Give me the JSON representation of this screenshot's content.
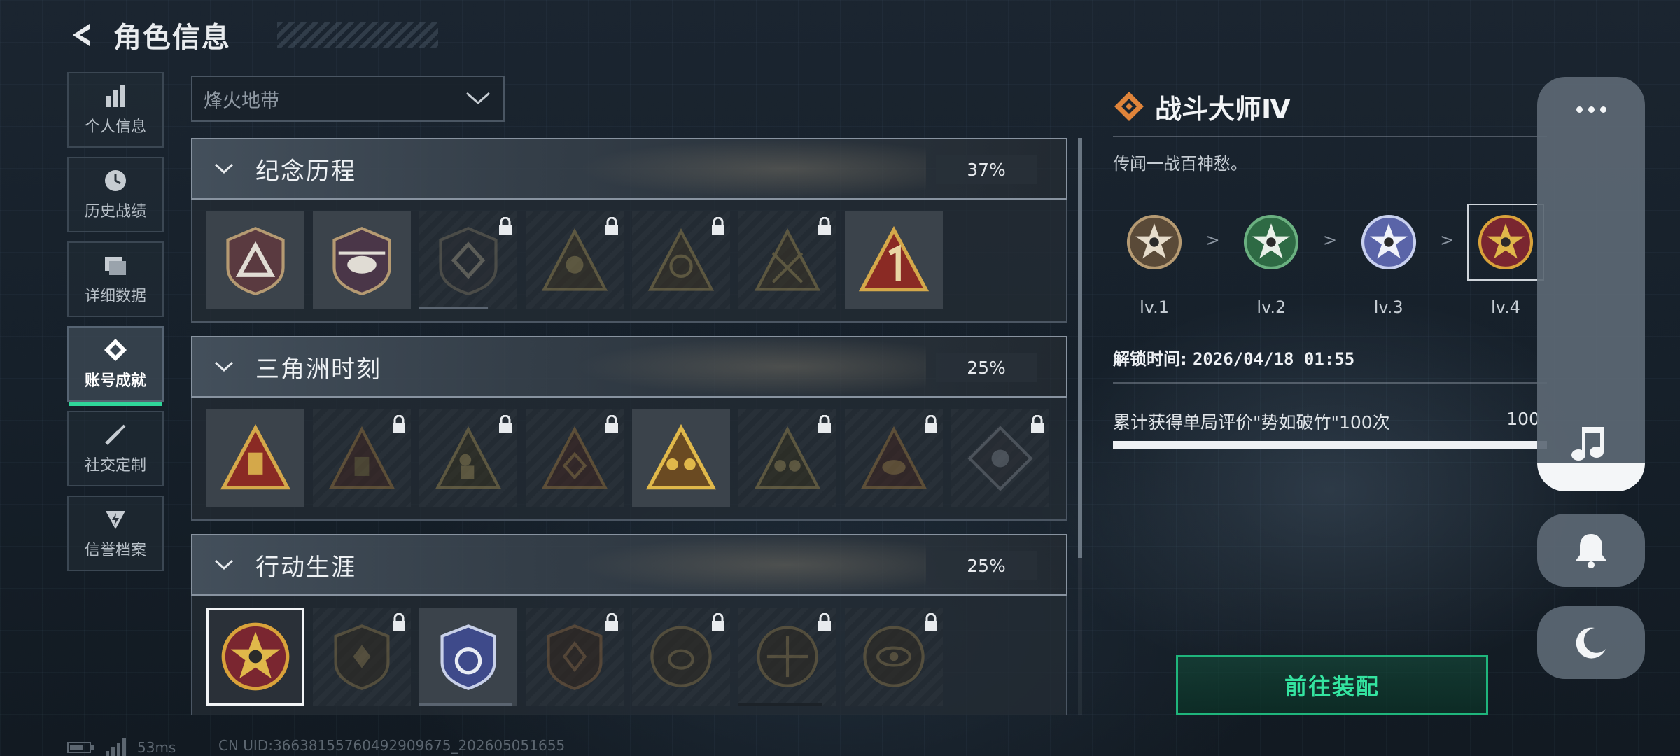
{
  "header": {
    "title": "角色信息"
  },
  "nav": [
    {
      "label": "个人信息",
      "icon": "bar-chart-icon"
    },
    {
      "label": "历史战绩",
      "icon": "clock-icon"
    },
    {
      "label": "详细数据",
      "icon": "folder-icon"
    },
    {
      "label": "账号成就",
      "icon": "achievement-icon",
      "active": true
    },
    {
      "label": "社交定制",
      "icon": "wrench-icon"
    },
    {
      "label": "信誉档案",
      "icon": "shield-bolt-icon"
    }
  ],
  "mode_select": {
    "value": "烽火地带"
  },
  "sections": [
    {
      "name": "纪念历程",
      "percent": "37%",
      "badges": 7,
      "locked": [
        2,
        3,
        4,
        5
      ]
    },
    {
      "name": "三角洲时刻",
      "percent": "25%",
      "badges": 8,
      "locked": [
        1,
        2,
        3,
        5,
        6,
        7
      ]
    },
    {
      "name": "行动生涯",
      "percent": "25%",
      "badges": 7,
      "locked": [
        1,
        3,
        4,
        5,
        6
      ]
    }
  ],
  "detail": {
    "title": "战斗大师Ⅳ",
    "description": "传闻一战百神愁。",
    "levels": [
      {
        "name": "lv.1",
        "color": "#b59a72"
      },
      {
        "name": "lv.2",
        "color": "#3f8a55"
      },
      {
        "name": "lv.3",
        "color": "#8e9ad0"
      },
      {
        "name": "lv.4",
        "color": "#d9a23a"
      }
    ],
    "level_separator": ">",
    "unlock_label": "解锁时间:",
    "unlock_time": "2026/04/18 01:55",
    "requirement": "累计获得单局评价\"势如破竹\"100次",
    "requirement_value": "100",
    "progress_fraction": 1.0,
    "equip_label": "前往装配"
  },
  "status": {
    "ping": "53ms",
    "uid": "CN UID:3663815576049290967­5_202605051655"
  },
  "colors": {
    "accent": "#2fd69a",
    "equip": "#34e3a0"
  }
}
